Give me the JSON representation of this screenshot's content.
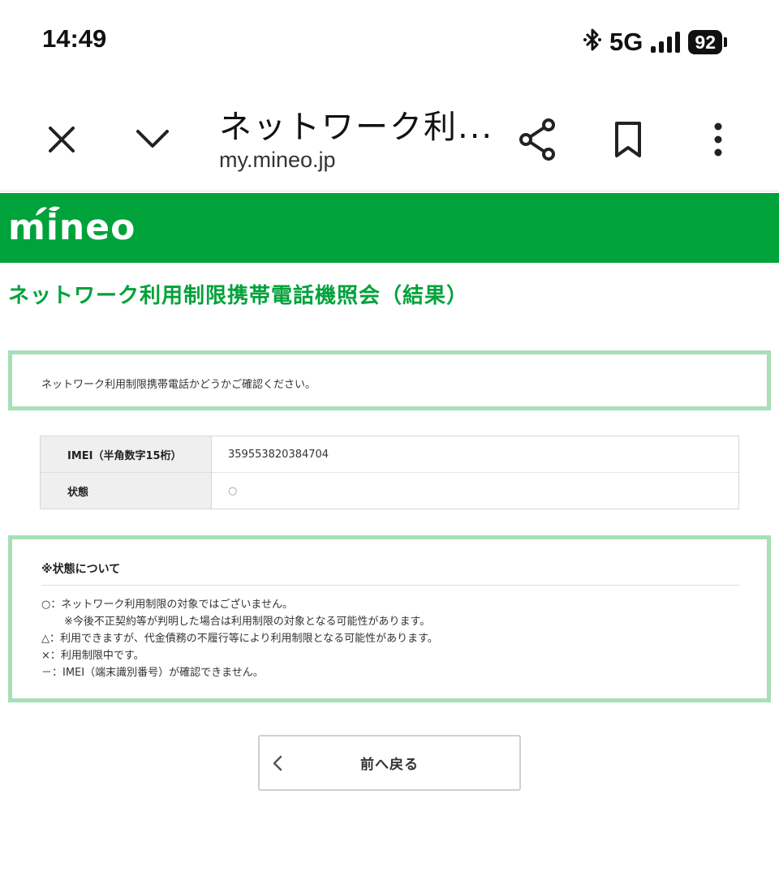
{
  "status_bar": {
    "time": "14:49",
    "network": "5G",
    "battery": "92",
    "icons": [
      "bluetooth-icon",
      "signal-icon",
      "battery-icon"
    ]
  },
  "browser": {
    "page_title": "ネットワーク利...",
    "url": "my.mineo.jp",
    "icons": [
      "close-icon",
      "chevron-down-icon",
      "share-icon",
      "bookmark-icon",
      "more-vert-icon"
    ]
  },
  "brand": {
    "logo_text": "mineo",
    "color": "#00a23a"
  },
  "page": {
    "title": "ネットワーク利用制限携帯電話機照会（結果）",
    "notice": "ネットワーク利用制限携帯電話かどうかご確認ください。",
    "table": [
      {
        "label": "IMEI（半角数字15桁）",
        "value": "359553820384704"
      },
      {
        "label": "状態",
        "value": "○"
      }
    ],
    "legend": {
      "heading": "※状態について",
      "items": [
        "○：ネットワーク利用制限の対象ではございません。",
        "※今後不正契約等が判明した場合は利用制限の対象となる可能性があります。",
        "△：利用できますが、代金債務の不履行等により利用制限となる可能性があります。",
        "×：利用制限中です。",
        "－：IMEI（端末識別番号）が確認できません。"
      ]
    },
    "back_button": "前へ戻る"
  },
  "colors": {
    "accent_green": "#00a23a",
    "box_border": "#a7dfb7"
  }
}
